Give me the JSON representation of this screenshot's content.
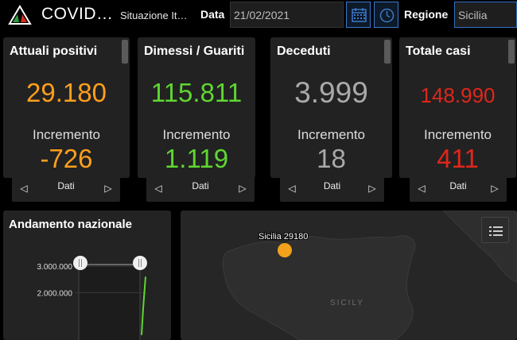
{
  "header": {
    "title": "COVID…",
    "subtitle": "Situazione It…",
    "date_label": "Data",
    "date_value": "21/02/2021",
    "region_label": "Regione",
    "region_value": "Sicilia",
    "logo_icon": "italy-flag-logo-icon",
    "calendar_icon": "calendar-icon",
    "clock_icon": "clock-icon"
  },
  "cards": [
    {
      "title": "Attuali positivi",
      "value": "29.180",
      "inc_label": "Incremento",
      "inc_value": "-726",
      "color": "#ff9f1c",
      "inc_color": "#ff9f1c",
      "nav_label": "Dati"
    },
    {
      "title": "Dimessi / Guariti",
      "value": "115.811",
      "inc_label": "Incremento",
      "inc_value": "1.119",
      "color": "#5fd631",
      "inc_color": "#5fd631",
      "nav_label": "Dati"
    },
    {
      "title": "Deceduti",
      "value": "3.999",
      "inc_label": "Incremento",
      "inc_value": "18",
      "color": "#a9a9a9",
      "inc_color": "#a9a9a9",
      "nav_label": "Dati"
    },
    {
      "title": "Totale casi",
      "value": "148.990",
      "inc_label": "Incremento",
      "inc_value": "411",
      "color": "#e0261b",
      "inc_color": "#e0261b",
      "nav_label": "Dati"
    }
  ],
  "chart_panel": {
    "title": "Andamento nazionale",
    "slider_handle_icon": "slider-handle-icon"
  },
  "chart_data": {
    "type": "line",
    "title": "Andamento nazionale",
    "y_ticks": [
      "3.000.000",
      "2.000.000"
    ],
    "ylim": [
      0,
      3300000
    ],
    "series": [
      {
        "values": [
          400000,
          1400000,
          2600000
        ],
        "color": "#5fd631"
      }
    ],
    "grid": true
  },
  "map": {
    "label_point": "Sicilia 29180",
    "region_name": "SICILY",
    "point_color": "#f2a11c",
    "legend_icon": "legend-list-icon"
  }
}
